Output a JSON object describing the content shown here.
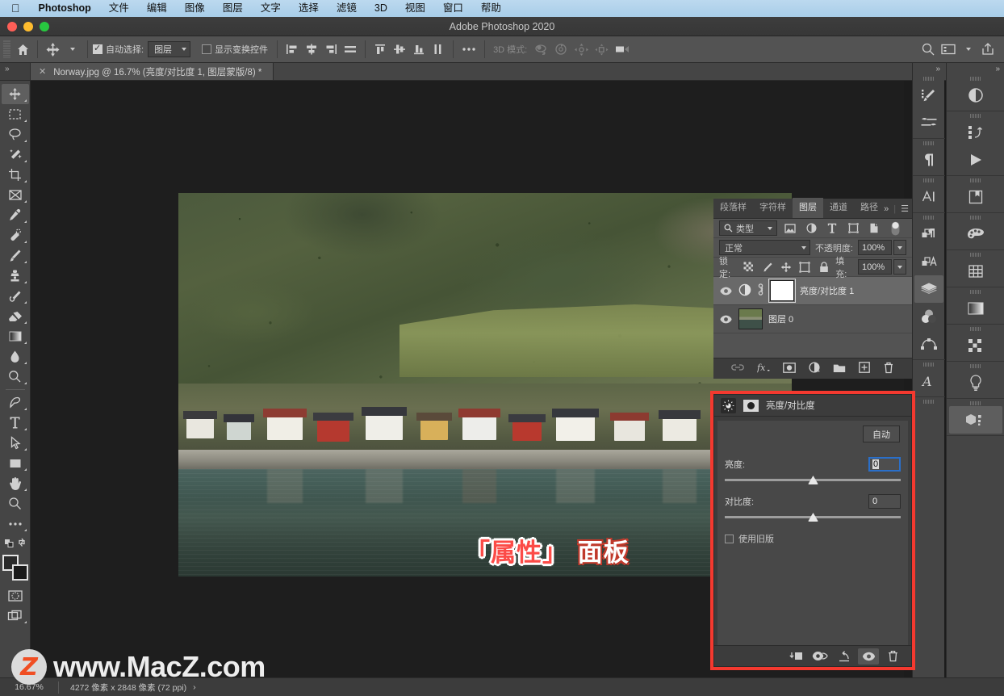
{
  "macbar": {
    "apple": "apple-logo",
    "items": [
      "Photoshop",
      "文件",
      "编辑",
      "图像",
      "图层",
      "文字",
      "选择",
      "滤镜",
      "3D",
      "视图",
      "窗口",
      "帮助"
    ]
  },
  "titlebar": {
    "title": "Adobe Photoshop 2020"
  },
  "optionsbar": {
    "home_tip": "Home",
    "tool_name": "Move Tool",
    "auto_select_label": "自动选择:",
    "auto_select_checked": true,
    "auto_select_value": "图层",
    "show_transform_label": "显示变换控件",
    "show_transform_checked": false,
    "more_label": "•••",
    "mode3d_label": "3D 模式:"
  },
  "tabbar": {
    "doc_title": "Norway.jpg @ 16.7% (亮度/对比度 1, 图层蒙版/8) *",
    "close_glyph": "✕",
    "chevrons": "»"
  },
  "canvas": {
    "annotation_bracket_open": "「",
    "annotation_red": "属性",
    "annotation_bracket_close": "」",
    "annotation_white": " 面板"
  },
  "toolbar": {
    "tools": [
      {
        "name": "move-tool",
        "selected": true
      },
      {
        "name": "rectangular-marquee-tool",
        "selected": false
      },
      {
        "name": "lasso-tool",
        "selected": false
      },
      {
        "name": "magic-wand-tool",
        "selected": false
      },
      {
        "name": "crop-tool",
        "selected": false
      },
      {
        "name": "frame-tool",
        "selected": false
      },
      {
        "name": "eyedropper-tool",
        "selected": false
      },
      {
        "name": "healing-brush-tool",
        "selected": false
      },
      {
        "name": "brush-tool",
        "selected": false
      },
      {
        "name": "clone-stamp-tool",
        "selected": false
      },
      {
        "name": "history-brush-tool",
        "selected": false
      },
      {
        "name": "eraser-tool",
        "selected": false
      },
      {
        "name": "gradient-tool",
        "selected": false
      },
      {
        "name": "blur-tool",
        "selected": false
      },
      {
        "name": "dodge-tool",
        "selected": false
      },
      {
        "name": "pen-tool",
        "selected": false
      },
      {
        "name": "type-tool",
        "selected": false
      },
      {
        "name": "path-selection-tool",
        "selected": false
      },
      {
        "name": "rectangle-tool",
        "selected": false
      },
      {
        "name": "hand-tool",
        "selected": false
      },
      {
        "name": "zoom-tool",
        "selected": false
      },
      {
        "name": "edit-toolbar-tool",
        "selected": false
      }
    ],
    "foreground_color": "#2b2b2b",
    "background_color": "#1b1b1b"
  },
  "layers_panel": {
    "tabs": [
      {
        "label": "段落样",
        "active": false
      },
      {
        "label": "字符样",
        "active": false
      },
      {
        "label": "图层",
        "active": true
      },
      {
        "label": "通道",
        "active": false
      },
      {
        "label": "路径",
        "active": false
      }
    ],
    "overflow": "»",
    "menu_glyph": "☰",
    "filter_label": "类型",
    "blend_mode": "正常",
    "opacity_label": "不透明度:",
    "opacity_value": "100%",
    "lock_label": "锁定:",
    "fill_label": "填充:",
    "fill_value": "100%",
    "layers": [
      {
        "name": "亮度/对比度 1",
        "visible": true,
        "selected": true,
        "kind": "adjustment-mask"
      },
      {
        "name": "图层 0",
        "visible": true,
        "selected": false,
        "kind": "image"
      }
    ],
    "bottom_buttons": [
      "link-layers-icon",
      "layer-style-icon",
      "add-mask-icon",
      "new-adjustment-icon",
      "new-group-icon",
      "new-layer-icon",
      "delete-layer-icon"
    ]
  },
  "properties_panel": {
    "header_title": "亮度/对比度",
    "adjustment_icon": "brightness-contrast-icon",
    "mask_icon": "mask-thumbnail-icon",
    "auto_button": "自动",
    "brightness": {
      "label": "亮度:",
      "value": "0",
      "focused": true,
      "slider_pct": 50
    },
    "contrast": {
      "label": "对比度:",
      "value": "0",
      "focused": false,
      "slider_pct": 50
    },
    "legacy_checkbox": {
      "label": "使用旧版",
      "checked": false
    },
    "bottom_buttons": [
      {
        "name": "clip-to-layer-icon",
        "active": false
      },
      {
        "name": "view-previous-state-icon",
        "active": false
      },
      {
        "name": "reset-icon",
        "active": false
      },
      {
        "name": "toggle-visibility-icon",
        "active": true
      },
      {
        "name": "delete-adjustment-icon",
        "active": false
      }
    ]
  },
  "rails": {
    "col1": [
      [
        "brush-settings-icon",
        "brush-presets-icon"
      ],
      [
        "paragraph-icon"
      ],
      [
        "character-icon"
      ],
      [
        "layer-comps-icon",
        "glyphs-icon",
        "layers-icon",
        "adjustments-icon",
        "paths-icon"
      ],
      [
        "styles-icon"
      ]
    ],
    "col2": [
      [
        "adjustments-panel-icon"
      ],
      [
        "history-icon",
        "actions-icon"
      ],
      [
        "notes-icon"
      ],
      [
        "swatches-icon"
      ],
      [
        "info-panel-icon"
      ],
      [
        "gradients-icon"
      ],
      [
        "patterns-icon"
      ],
      [
        "learn-icon"
      ],
      [
        "3d-panel-icon"
      ]
    ]
  },
  "statusbar": {
    "zoom": "16.67%",
    "doc_info": "4272 像素 x 2848 像素 (72 ppi)",
    "chevron": "›"
  },
  "watermark": {
    "badge": "Z",
    "text": "www.MacZ.com"
  },
  "colors": {
    "accent_red": "#f4392f",
    "panel_bg": "#3c3c3c",
    "panel_light": "#535353",
    "focus_blue": "#2a6fc9",
    "menubar_blue": "#b4d5ec"
  }
}
